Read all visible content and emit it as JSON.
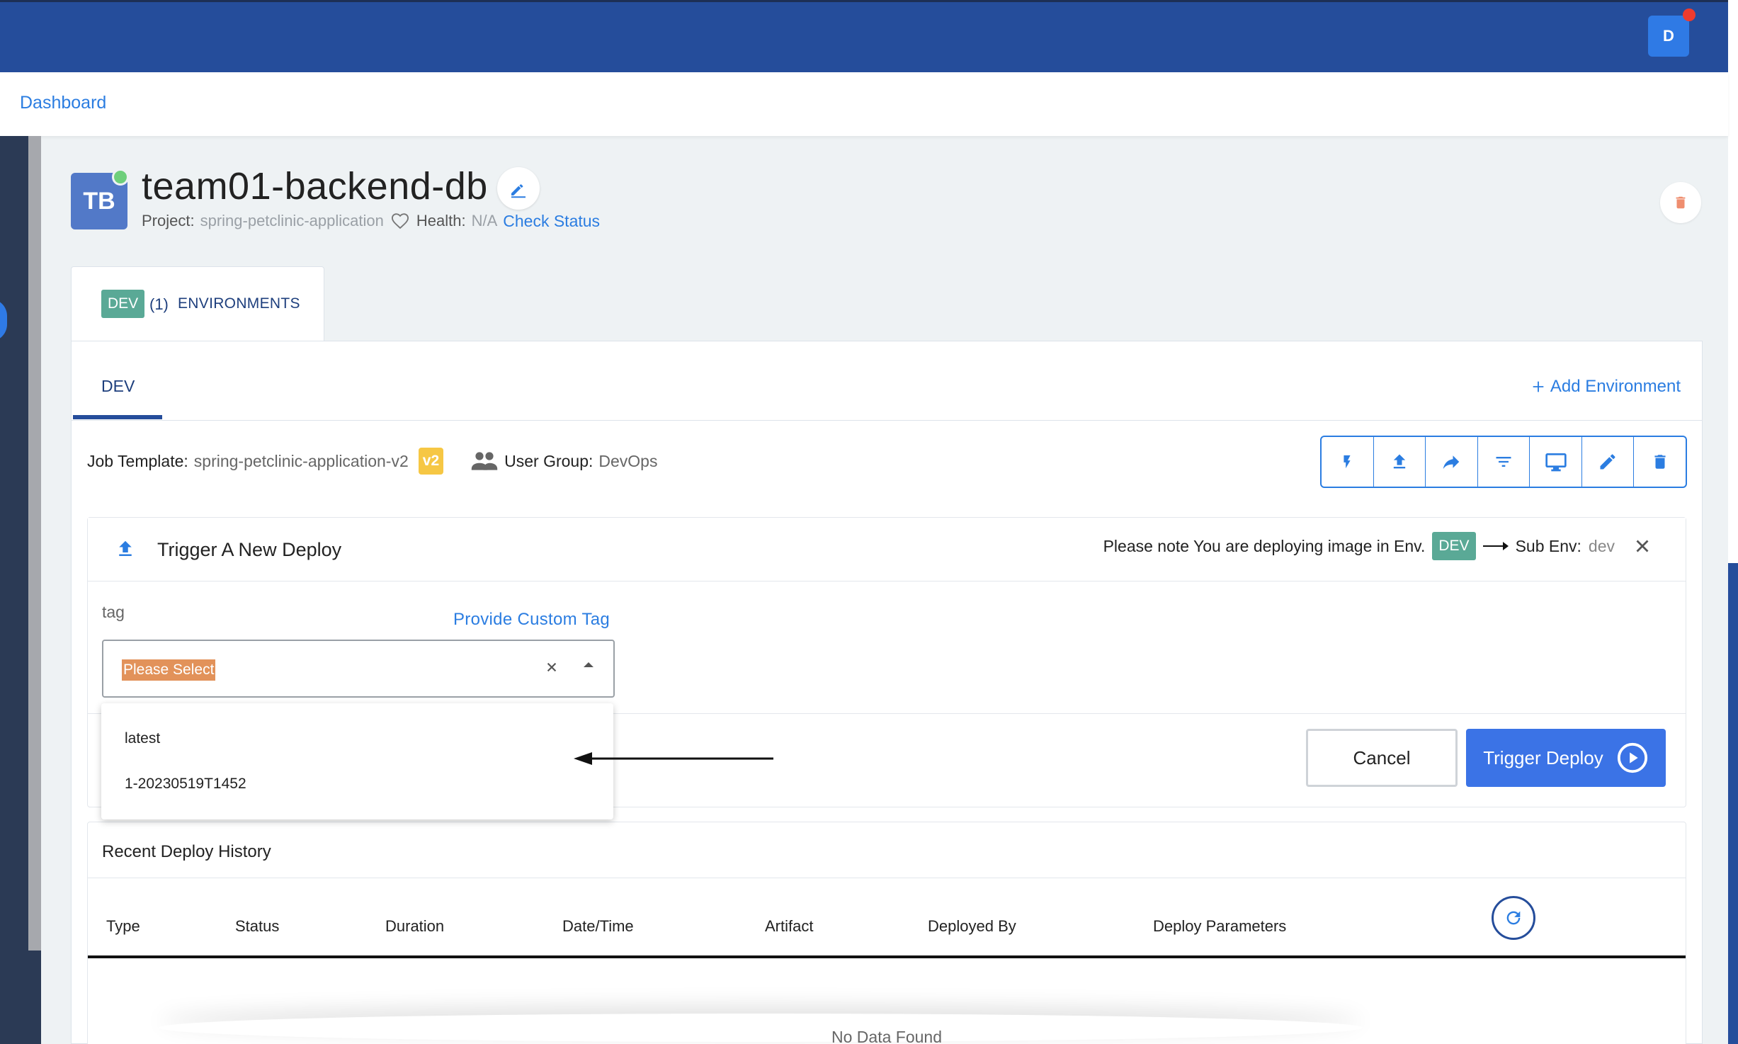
{
  "header": {
    "user_initial": "D"
  },
  "breadcrumb": {
    "dashboard": "Dashboard"
  },
  "service": {
    "avatar_initials": "TB",
    "title": "team01-backend-db",
    "project_label": "Project:",
    "project_value": "spring-petclinic-application",
    "health_label": "Health:",
    "health_value": "N/A",
    "check_status": "Check Status"
  },
  "env_tab": {
    "badge": "DEV",
    "count": "(1)",
    "label": "ENVIRONMENTS"
  },
  "subtabs": {
    "active": "DEV",
    "add_environment": "Add Environment"
  },
  "job": {
    "template_label": "Job Template:",
    "template_value": "spring-petclinic-application-v2",
    "version_badge": "v2",
    "user_group_label": "User Group:",
    "user_group_value": "DevOps"
  },
  "toolbar": {
    "icons": [
      "flash-icon",
      "upload-icon",
      "share-icon",
      "filter-icon",
      "monitor-icon",
      "edit-icon",
      "delete-icon"
    ]
  },
  "deploy": {
    "title": "Trigger A New Deploy",
    "note": "Please note You are deploying image in Env.",
    "env_badge": "DEV",
    "sub_env_label": "Sub Env:",
    "sub_env_value": "dev",
    "tag_label": "tag",
    "custom_tag_link": "Provide Custom Tag",
    "select_placeholder": "Please Select",
    "options": [
      "latest",
      "1-20230519T1452"
    ],
    "cancel_label": "Cancel",
    "trigger_label": "Trigger Deploy"
  },
  "history": {
    "title": "Recent Deploy History",
    "columns": [
      "Type",
      "Status",
      "Duration",
      "Date/Time",
      "Artifact",
      "Deployed By",
      "Deploy Parameters"
    ],
    "empty": "No Data Found"
  },
  "colors": {
    "topbar": "#254d9b",
    "accent": "#2b7de1",
    "dev_badge": "#5aa996",
    "version_badge": "#f6c744",
    "trigger_button": "#3b73e6",
    "notification": "#ef3b2d"
  }
}
